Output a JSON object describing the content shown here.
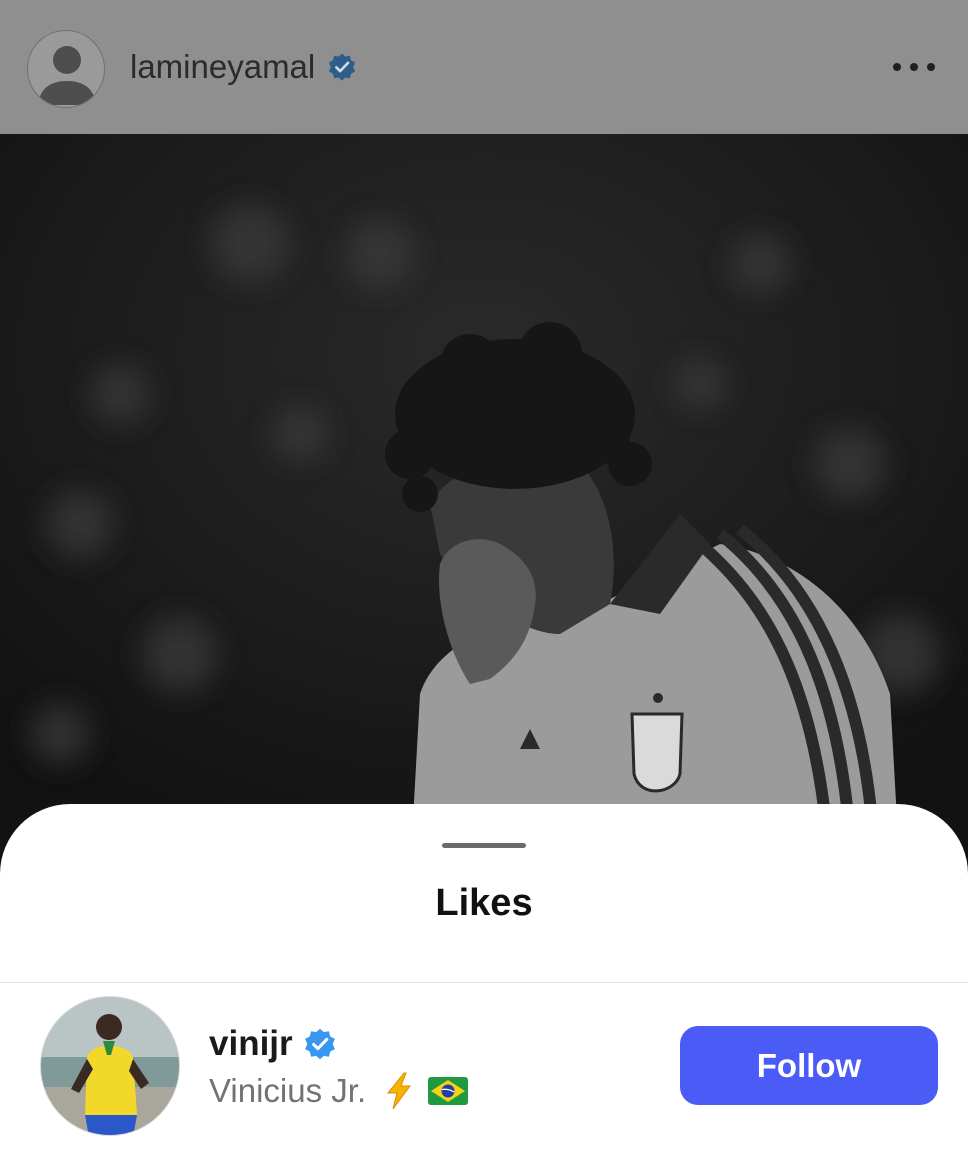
{
  "post": {
    "username": "lamineyamal",
    "verified": true,
    "more_icon": "more-horizontal-icon",
    "avatar_icon": "default-avatar-icon"
  },
  "sheet": {
    "title": "Likes"
  },
  "likes": [
    {
      "username": "vinijr",
      "verified": true,
      "full_name": "Vinicius Jr.",
      "emojis": [
        "bolt-icon",
        "brazil-flag-icon"
      ],
      "button_label": "Follow"
    }
  ],
  "colors": {
    "follow_button": "#4a5cf5",
    "verified_badge": "#3897f0",
    "overlay_header": "#8f8f90"
  }
}
